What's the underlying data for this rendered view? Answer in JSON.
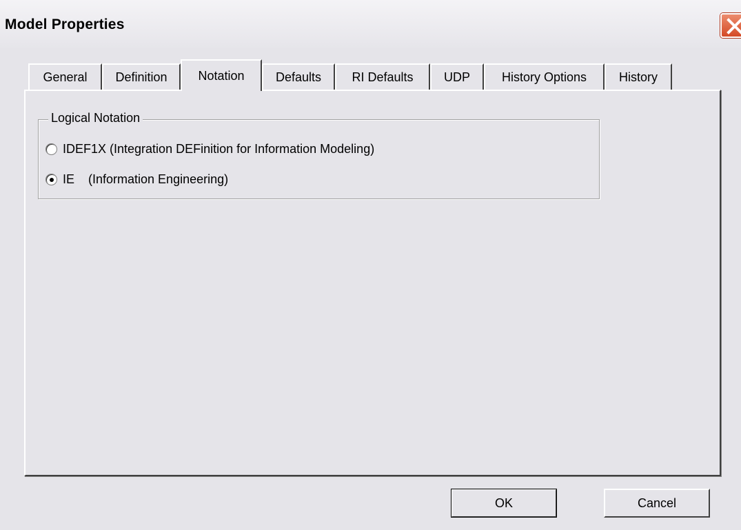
{
  "window": {
    "title": "Model Properties"
  },
  "tabs": [
    {
      "label": "General",
      "active": false
    },
    {
      "label": "Definition",
      "active": false
    },
    {
      "label": "Notation",
      "active": true
    },
    {
      "label": "Defaults",
      "active": false
    },
    {
      "label": "RI Defaults",
      "active": false
    },
    {
      "label": "UDP",
      "active": false
    },
    {
      "label": "History Options",
      "active": false
    },
    {
      "label": "History",
      "active": false
    }
  ],
  "notation": {
    "group_label": "Logical Notation",
    "options": [
      {
        "label": "IDEF1X (Integration DEFinition for Information Modeling)",
        "checked": false
      },
      {
        "label": "IE    (Information Engineering)",
        "checked": true
      }
    ]
  },
  "buttons": {
    "ok": "OK",
    "cancel": "Cancel"
  }
}
